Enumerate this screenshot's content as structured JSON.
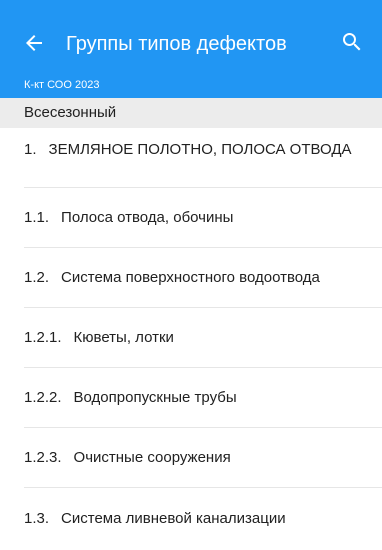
{
  "appbar": {
    "title": "Группы типов дефектов",
    "subtitle": "К-кт СОО 2023",
    "color": "#2196f3",
    "back_icon": "arrow-left-icon",
    "search_icon": "search-icon"
  },
  "section": {
    "header": "Всесезонный"
  },
  "items": [
    {
      "num": "1.",
      "label": "ЗЕМЛЯНОЕ ПОЛОТНО, ПОЛОСА ОТВОДА"
    },
    {
      "num": "1.1.",
      "label": "Полоса отвода, обочины"
    },
    {
      "num": "1.2.",
      "label": "Система поверхностного водоотвода"
    },
    {
      "num": "1.2.1.",
      "label": "Кюветы, лотки"
    },
    {
      "num": "1.2.2.",
      "label": "Водопропускные трубы"
    },
    {
      "num": "1.2.3.",
      "label": "Очистные сооружения"
    },
    {
      "num": "1.3.",
      "label": "Система ливневой канализации"
    }
  ]
}
